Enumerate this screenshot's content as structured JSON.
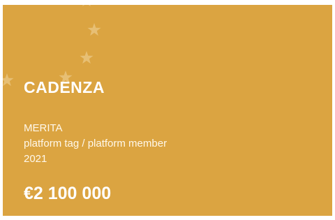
{
  "card": {
    "title": "CADENZA",
    "programme": "MERITA",
    "tags": "platform tag / platform member",
    "year": "2021",
    "amount": "€2 100 000",
    "background_color": "#dba441",
    "decoration_icon": "eu-stars-icon"
  }
}
